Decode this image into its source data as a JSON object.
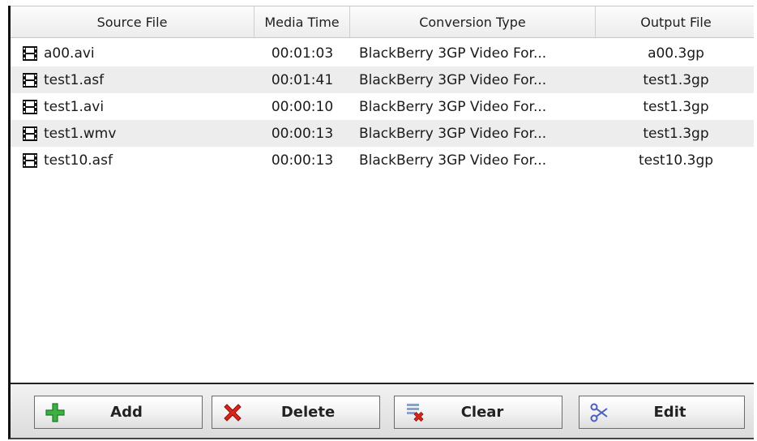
{
  "table": {
    "columns": [
      "Source File",
      "Media Time",
      "Conversion Type",
      "Output File"
    ],
    "rows": [
      {
        "icon": "film-icon",
        "source": "a00.avi",
        "time": "00:01:03",
        "type": "BlackBerry 3GP Video For...",
        "output": "a00.3gp"
      },
      {
        "icon": "film-icon",
        "source": "test1.asf",
        "time": "00:01:41",
        "type": "BlackBerry 3GP Video For...",
        "output": "test1.3gp"
      },
      {
        "icon": "film-icon",
        "source": "test1.avi",
        "time": "00:00:10",
        "type": "BlackBerry 3GP Video For...",
        "output": "test1.3gp"
      },
      {
        "icon": "film-icon",
        "source": "test1.wmv",
        "time": "00:00:13",
        "type": "BlackBerry 3GP Video For...",
        "output": "test1.3gp"
      },
      {
        "icon": "film-icon",
        "source": "test10.asf",
        "time": "00:00:13",
        "type": "BlackBerry 3GP Video For...",
        "output": "test10.3gp"
      }
    ]
  },
  "toolbar": {
    "add_label": "Add",
    "delete_label": "Delete",
    "clear_label": "Clear",
    "edit_label": "Edit"
  },
  "colors": {
    "add_icon": "#3cb043",
    "delete_icon": "#d9261c",
    "clear_icon": "#d9261c",
    "edit_icon": "#4a5fbf",
    "alt_row": "#ededed"
  }
}
